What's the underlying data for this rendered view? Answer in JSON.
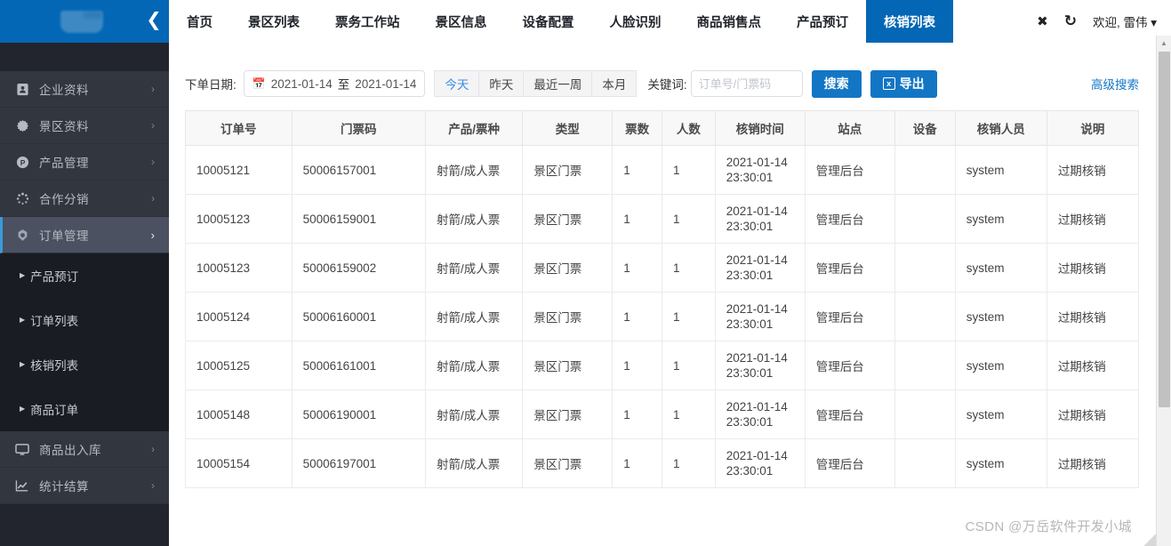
{
  "sidebar": {
    "logo_icon": "app-logo",
    "collapse_icon": "chevron-left-icon",
    "items": [
      {
        "label": "企业资料",
        "icon": "id-card-icon",
        "arrow": "›",
        "active": false
      },
      {
        "label": "景区资料",
        "icon": "flower-icon",
        "arrow": "›",
        "active": false
      },
      {
        "label": "产品管理",
        "icon": "p-circle-icon",
        "arrow": "›",
        "active": false
      },
      {
        "label": "合作分销",
        "icon": "loading-dots-icon",
        "arrow": "›",
        "active": false
      },
      {
        "label": "订单管理",
        "icon": "hexagon-icon",
        "arrow": "›",
        "active": true
      }
    ],
    "sub_items": [
      {
        "label": "产品预订"
      },
      {
        "label": "订单列表"
      },
      {
        "label": "核销列表"
      },
      {
        "label": "商品订单"
      }
    ],
    "items_after": [
      {
        "label": "商品出入库",
        "icon": "monitor-icon",
        "arrow": "›",
        "active": false
      },
      {
        "label": "统计结算",
        "icon": "chart-line-icon",
        "arrow": "›",
        "active": false
      }
    ]
  },
  "topnav": {
    "tabs": [
      {
        "label": "首页",
        "active": false
      },
      {
        "label": "景区列表",
        "active": false
      },
      {
        "label": "票务工作站",
        "active": false
      },
      {
        "label": "景区信息",
        "active": false
      },
      {
        "label": "设备配置",
        "active": false
      },
      {
        "label": "人脸识别",
        "active": false
      },
      {
        "label": "商品销售点",
        "active": false
      },
      {
        "label": "产品预订",
        "active": false
      },
      {
        "label": "核销列表",
        "active": true
      }
    ],
    "close_icon": "close-icon",
    "refresh_icon": "refresh-icon",
    "welcome": "欢迎, 雷伟 ▾"
  },
  "filter": {
    "date_label": "下单日期:",
    "calendar_icon": "calendar-icon",
    "date_start": "2021-01-14",
    "date_separator": "至",
    "date_end": "2021-01-14",
    "quick_ranges": [
      {
        "label": "今天",
        "selected": true
      },
      {
        "label": "昨天",
        "selected": false
      },
      {
        "label": "最近一周",
        "selected": false
      },
      {
        "label": "本月",
        "selected": false
      }
    ],
    "keyword_label": "关键词:",
    "keyword_value": "",
    "keyword_placeholder": "订单号/门票码",
    "search_button": "搜索",
    "export_button": "导出",
    "export_icon": "excel-file-icon",
    "export_icon_glyph": "x",
    "advanced_search": "高级搜索"
  },
  "table": {
    "columns": [
      "订单号",
      "门票码",
      "产品/票种",
      "类型",
      "票数",
      "人数",
      "核销时间",
      "站点",
      "设备",
      "核销人员",
      "说明"
    ],
    "rows": [
      {
        "order_no": "10005121",
        "ticket_code": "50006157001",
        "product": "射箭/成人票",
        "type": "景区门票",
        "tickets": "1",
        "people": "1",
        "verify_time": "2021-01-14 23:30:01",
        "station": "管理后台",
        "device": "",
        "operator": "system",
        "note": "过期核销"
      },
      {
        "order_no": "10005123",
        "ticket_code": "50006159001",
        "product": "射箭/成人票",
        "type": "景区门票",
        "tickets": "1",
        "people": "1",
        "verify_time": "2021-01-14 23:30:01",
        "station": "管理后台",
        "device": "",
        "operator": "system",
        "note": "过期核销"
      },
      {
        "order_no": "10005123",
        "ticket_code": "50006159002",
        "product": "射箭/成人票",
        "type": "景区门票",
        "tickets": "1",
        "people": "1",
        "verify_time": "2021-01-14 23:30:01",
        "station": "管理后台",
        "device": "",
        "operator": "system",
        "note": "过期核销"
      },
      {
        "order_no": "10005124",
        "ticket_code": "50006160001",
        "product": "射箭/成人票",
        "type": "景区门票",
        "tickets": "1",
        "people": "1",
        "verify_time": "2021-01-14 23:30:01",
        "station": "管理后台",
        "device": "",
        "operator": "system",
        "note": "过期核销"
      },
      {
        "order_no": "10005125",
        "ticket_code": "50006161001",
        "product": "射箭/成人票",
        "type": "景区门票",
        "tickets": "1",
        "people": "1",
        "verify_time": "2021-01-14 23:30:01",
        "station": "管理后台",
        "device": "",
        "operator": "system",
        "note": "过期核销"
      },
      {
        "order_no": "10005148",
        "ticket_code": "50006190001",
        "product": "射箭/成人票",
        "type": "景区门票",
        "tickets": "1",
        "people": "1",
        "verify_time": "2021-01-14 23:30:01",
        "station": "管理后台",
        "device": "",
        "operator": "system",
        "note": "过期核销"
      },
      {
        "order_no": "10005154",
        "ticket_code": "50006197001",
        "product": "射箭/成人票",
        "type": "景区门票",
        "tickets": "1",
        "people": "1",
        "verify_time": "2021-01-14 23:30:01",
        "station": "管理后台",
        "device": "",
        "operator": "system",
        "note": "过期核销"
      }
    ]
  },
  "watermark": "CSDN @万岳软件开发小城",
  "colors": {
    "brand_blue": "#0367b5",
    "button_blue": "#1376c5",
    "sidebar_bg": "#22252e",
    "sidebar_item_bg": "#32363f",
    "sidebar_active": "#4b5160",
    "sidebar_sub_bg": "#191c23",
    "link_blue": "#3a8ee6"
  }
}
